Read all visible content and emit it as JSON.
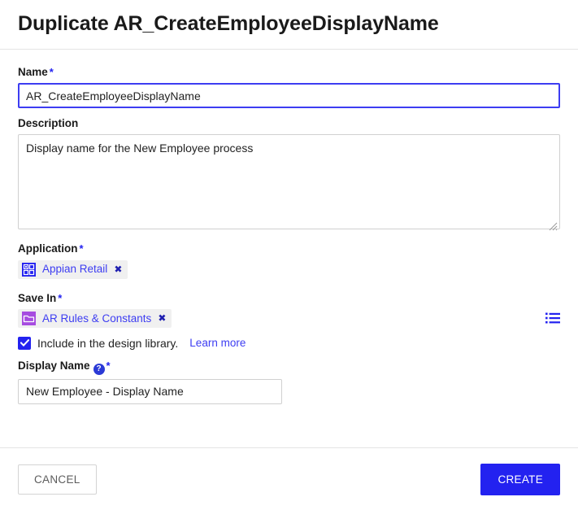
{
  "dialog": {
    "title": "Duplicate AR_CreateEmployeeDisplayName"
  },
  "fields": {
    "name": {
      "label": "Name",
      "required_marker": "*",
      "value": "AR_CreateEmployeeDisplayName",
      "placeholder": ""
    },
    "description": {
      "label": "Description",
      "value": "Display name for the New Employee process",
      "placeholder": ""
    },
    "application": {
      "label": "Application",
      "required_marker": "*",
      "chip": {
        "icon": "application-grid-icon",
        "label": "Appian Retail",
        "remove_label": "✖"
      }
    },
    "save_in": {
      "label": "Save In",
      "required_marker": "*",
      "chip": {
        "icon": "folder-icon",
        "label": "AR Rules & Constants",
        "remove_label": "✖"
      },
      "browse_icon": "list-browse-icon"
    },
    "design_library": {
      "checked": true,
      "label": "Include in the design library.",
      "link_label": "Learn more"
    },
    "display_name": {
      "label": "Display Name",
      "help_icon_glyph": "?",
      "required_marker": "*",
      "value": "New Employee - Display Name",
      "placeholder": ""
    }
  },
  "footer": {
    "cancel_label": "CANCEL",
    "create_label": "CREATE"
  },
  "colors": {
    "accent": "#2322f0",
    "link": "#3d3df2",
    "chip_background": "#f0f0f0",
    "folder_icon": "#a64be0",
    "border": "#d0d0d0"
  }
}
